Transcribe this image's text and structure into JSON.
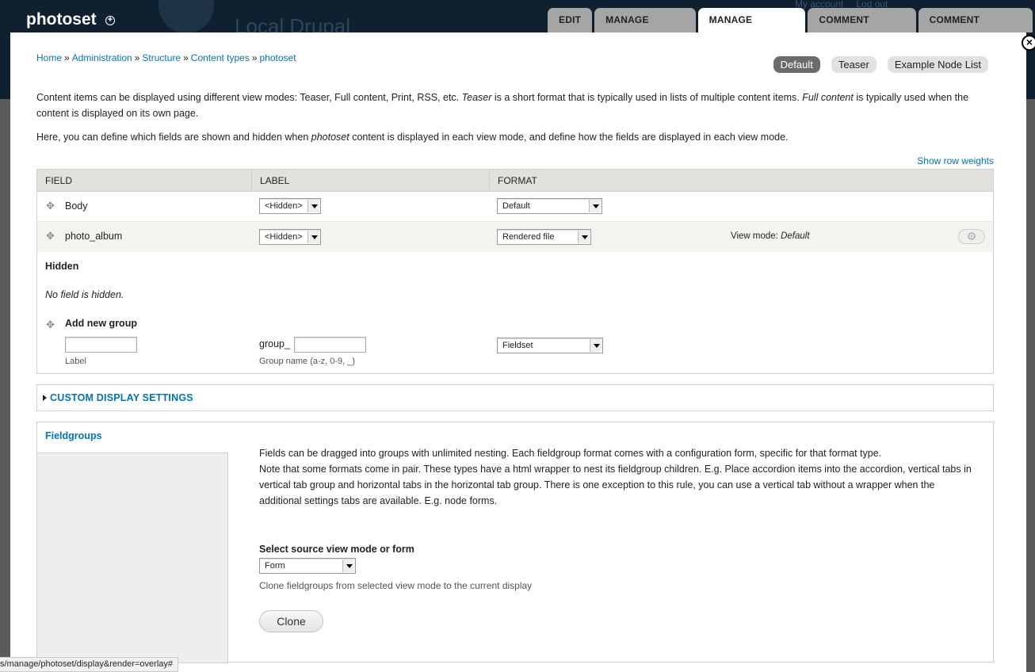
{
  "site": {
    "title": "photoset",
    "ghost_site_name": "Local Drupal",
    "ghost_links": [
      "My account",
      "Log out"
    ]
  },
  "tabs": [
    {
      "label": "EDIT",
      "active": false
    },
    {
      "label": "MANAGE FIELDS",
      "active": false
    },
    {
      "label": "MANAGE DISPLAY",
      "active": true
    },
    {
      "label": "COMMENT FIELDS",
      "active": false
    },
    {
      "label": "COMMENT DISPLAY",
      "active": false
    }
  ],
  "breadcrumb": [
    "Home",
    "Administration",
    "Structure",
    "Content types",
    "photoset"
  ],
  "breadcrumb_separator": "»",
  "view_modes": [
    {
      "label": "Default",
      "active": true
    },
    {
      "label": "Teaser",
      "active": false
    },
    {
      "label": "Example Node List",
      "active": false
    }
  ],
  "help": {
    "p1a": "Content items can be displayed using different view modes: Teaser, Full content, Print, RSS, etc. ",
    "p1b": "Teaser",
    "p1c": " is a short format that is typically used in lists of multiple content items. ",
    "p1d": "Full content",
    "p1e": " is typically used when the content is displayed on its own page.",
    "p2a": "Here, you can define which fields are shown and hidden when ",
    "p2b": "photoset",
    "p2c": " content is displayed in each view mode, and define how the fields are displayed in each view mode."
  },
  "show_row_weights": "Show row weights",
  "table": {
    "headers": [
      "FIELD",
      "LABEL",
      "FORMAT"
    ],
    "rows": [
      {
        "field": "Body",
        "label": "<Hidden>",
        "format": "Default"
      },
      {
        "field": "photo_album",
        "label": "<Hidden>",
        "format": "Rendered file",
        "view_mode_label": "View mode:",
        "view_mode_value": "Default"
      }
    ],
    "hidden_region": "Hidden",
    "no_hidden": "No field is hidden.",
    "add_group": {
      "title": "Add new group",
      "label_caption": "Label",
      "prefix": "group_",
      "name_caption": "Group name (a-z, 0-9, _)",
      "format": "Fieldset"
    }
  },
  "custom_display": "CUSTOM DISPLAY SETTINGS",
  "fieldgroups": {
    "title": "Fieldgroups",
    "desc1": "Fields can be dragged into groups with unlimited nesting. Each fieldgroup format comes with a configuration form, specific for that format type.",
    "desc2": "Note that some formats come in pair. These types have a html wrapper to nest its fieldgroup children. E.g. Place accordion items into the accordion, vertical tabs in vertical tab group and horizontal tabs in the horizontal tab group. There is one exception to this rule, you can use a vertical tab without a wrapper when the additional settings tabs are available. E.g. node forms.",
    "select_label": "Select source view mode or form",
    "select_value": "Form",
    "hint": "Clone fieldgroups from selected view mode to the current display",
    "clone_label": "Clone"
  },
  "status_url": "s/manage/photoset/display&render=overlay#",
  "icons": {
    "shortcut": "shortcut-add-icon",
    "close": "close-icon",
    "drag": "drag-handle-icon",
    "gear": "gear-icon",
    "collapse": "collapse-triangle-icon"
  },
  "colors": {
    "link": "#0074bd",
    "toolbar": "#0f2030",
    "tab_inactive": "#a5a5a5",
    "active_view_mode": "#6b6b6b"
  }
}
